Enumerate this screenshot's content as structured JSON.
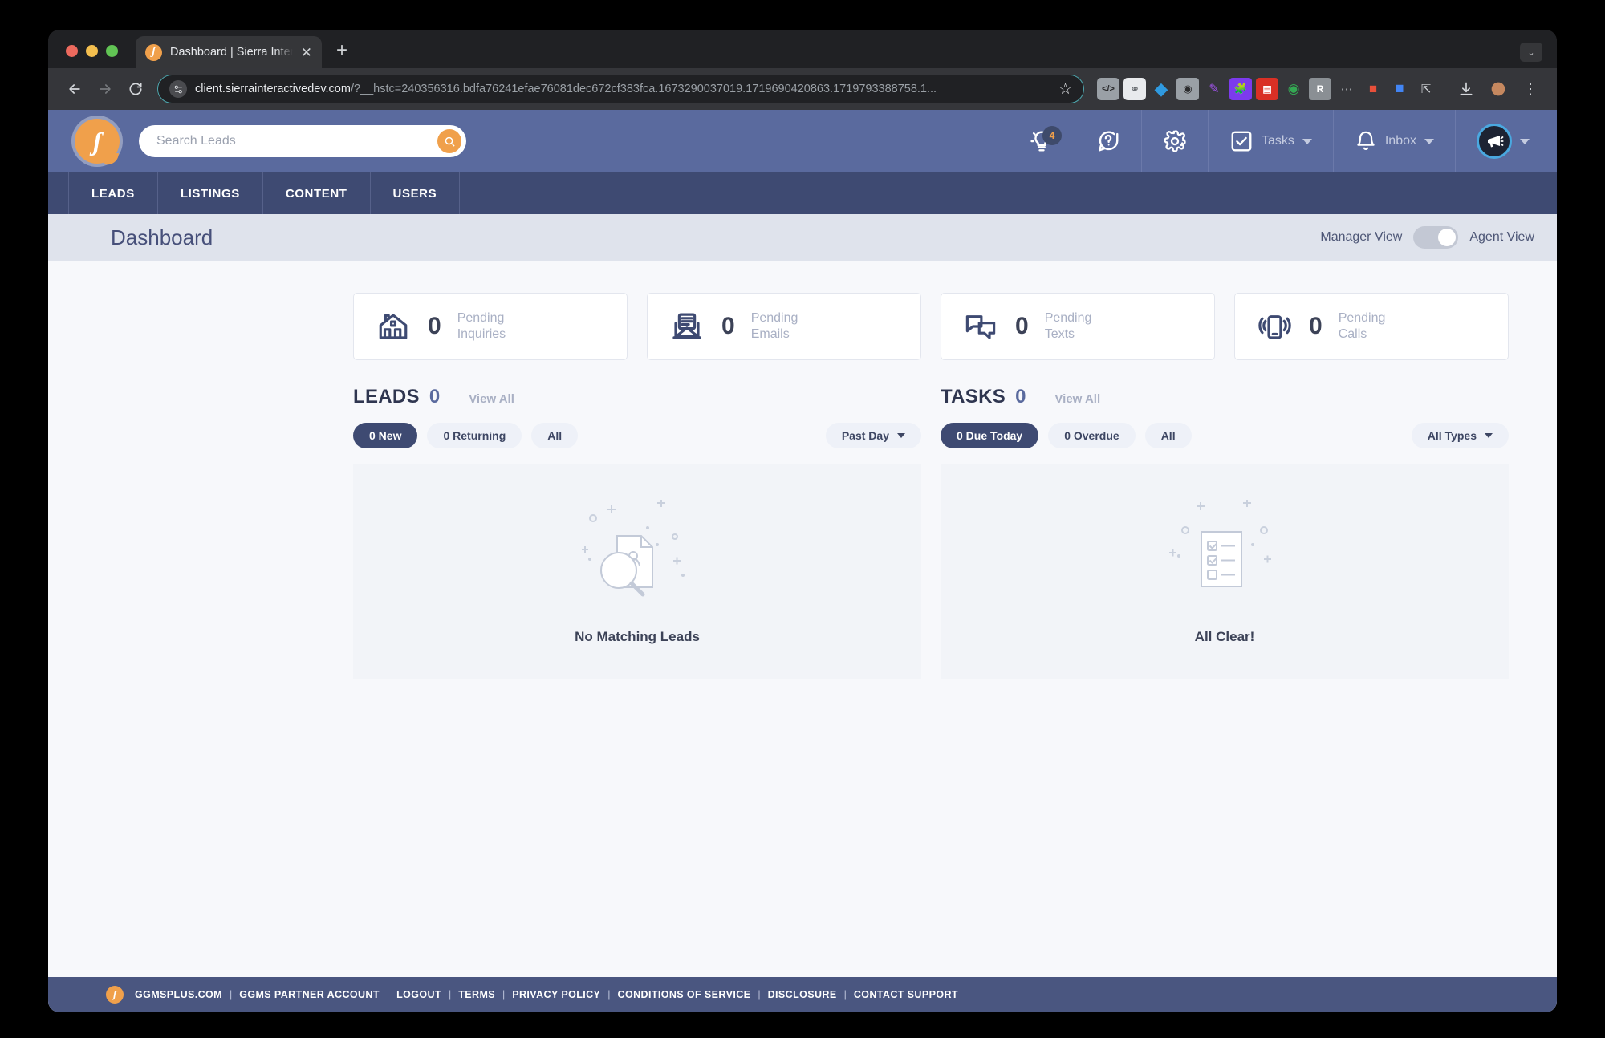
{
  "browser": {
    "tab": {
      "title": "Dashboard | Sierra Interactive",
      "favicon": "sierra-logo-icon",
      "close": "✕"
    },
    "new_tab": "+",
    "window_menu": "⌄",
    "nav": {
      "back": "back-arrow-icon",
      "forward": "forward-arrow-icon",
      "reload": "reload-icon"
    },
    "omnibox": {
      "domain": "client.sierrainteractivedev.com",
      "path": "/?__hstc=240356316.bdfa76241efae76081dec672cf383fca.1673290037019.1719690420863.1719793388758.1...",
      "lock": "site-settings-icon",
      "star": "☆"
    },
    "extensions": [
      "code-icon",
      "link-icon",
      "diamond-icon",
      "camera-icon",
      "pen-icon",
      "puzzle-icon",
      "g-icon",
      "r-icon",
      "dots-icon",
      "flame-icon",
      "square-icon",
      "share-icon"
    ],
    "downloads": "download-icon",
    "profile": "profile-avatar-icon",
    "menu": "⋮"
  },
  "app": {
    "logo": "ʃ",
    "search": {
      "placeholder": "Search Leads",
      "value": "",
      "button_icon": "search-icon"
    },
    "header_actions": [
      {
        "name": "ideas",
        "icon": "lightbulb-icon",
        "badge": "4"
      },
      {
        "name": "help",
        "icon": "question-circle-icon",
        "badge": ""
      },
      {
        "name": "settings",
        "icon": "gear-icon",
        "badge": ""
      },
      {
        "name": "tasks",
        "icon": "checkbox-icon",
        "label": "Tasks",
        "badge": ""
      },
      {
        "name": "inbox",
        "icon": "bell-icon",
        "label": "Inbox",
        "badge": ""
      }
    ],
    "nav_tabs": [
      "LEADS",
      "LISTINGS",
      "CONTENT",
      "USERS"
    ],
    "page_title": "Dashboard",
    "view_toggle": {
      "left_label": "Manager View",
      "right_label": "Agent View",
      "state": "agent"
    },
    "stats": [
      {
        "icon": "house-icon",
        "value": "0",
        "label_line1": "Pending",
        "label_line2": "Inquiries"
      },
      {
        "icon": "envelope-icon",
        "value": "0",
        "label_line1": "Pending",
        "label_line2": "Emails"
      },
      {
        "icon": "chat-icon",
        "value": "0",
        "label_line1": "Pending",
        "label_line2": "Texts"
      },
      {
        "icon": "phone-icon",
        "value": "0",
        "label_line1": "Pending",
        "label_line2": "Calls"
      }
    ],
    "leads_panel": {
      "title": "LEADS",
      "count": "0",
      "view_all": "View All",
      "chips": [
        "0 New",
        "0 Returning",
        "All"
      ],
      "active_chip": "0 New",
      "filter": "Past Day",
      "empty_text": "No Matching Leads",
      "empty_icon": "document-magnifier-icon"
    },
    "tasks_panel": {
      "title": "TASKS",
      "count": "0",
      "view_all": "View All",
      "chips": [
        "0 Due Today",
        "0 Overdue",
        "All"
      ],
      "active_chip": "0 Due Today",
      "filter": "All Types",
      "empty_text": "All Clear!",
      "empty_icon": "checklist-icon"
    },
    "footer": {
      "logo": "ʃ",
      "links": [
        "GGMSPLUS.COM",
        "GGMS PARTNER ACCOUNT",
        "LOGOUT",
        "TERMS",
        "PRIVACY POLICY",
        "CONDITIONS OF SERVICE",
        "DISCLOSURE",
        "CONTACT SUPPORT"
      ],
      "separator": "|"
    }
  },
  "colors": {
    "header_blue": "#5a6a9e",
    "nav_blue": "#3e4a72",
    "accent_orange": "#f0a04b",
    "page_bg": "#f7f8fb"
  }
}
